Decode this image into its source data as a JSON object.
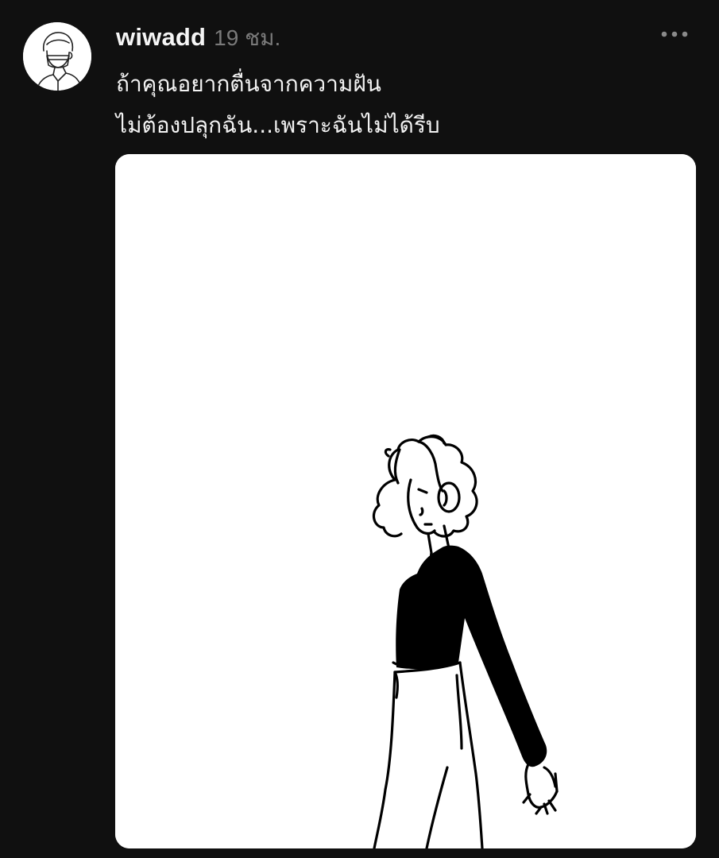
{
  "post": {
    "author": {
      "username": "wiwadd",
      "avatar_icon": "avatar-portrait-line-drawing"
    },
    "timestamp": "19 ชม.",
    "more_icon": "more-horizontal-icon",
    "caption_lines": [
      "ถ้าคุณอยากตื่นจากความฝัน",
      "ไม่ต้องปลุกฉัน...เพราะฉันไม่ได้รีบ"
    ],
    "image": {
      "subject": "line-drawing-woman-with-headphones",
      "background_color": "#ffffff",
      "ink_color": "#000000"
    }
  },
  "theme": {
    "background": "#101010",
    "text_primary": "#f3f3f3",
    "text_secondary": "#7a7a7a"
  }
}
